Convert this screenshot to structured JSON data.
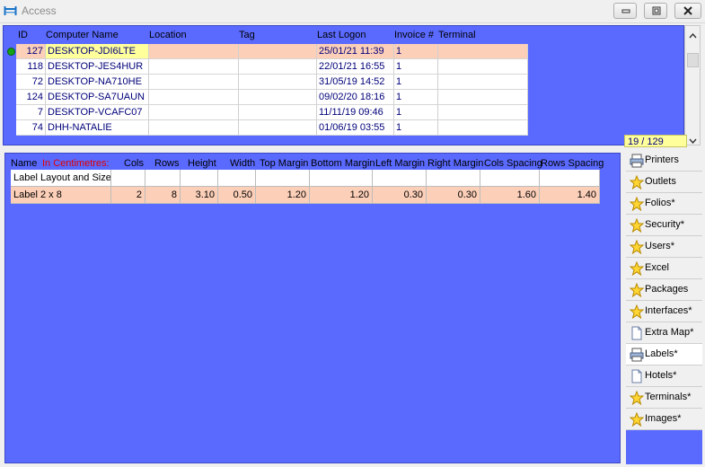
{
  "window": {
    "title": "Access",
    "icon": "app-window-icon",
    "buttons": [
      "minimize-icon",
      "maximize-icon",
      "close-icon"
    ]
  },
  "top_grid": {
    "columns": [
      "ID",
      "Computer Name",
      "Location",
      "Tag",
      "Last Logon",
      "Invoice #",
      "Terminal"
    ],
    "rows": [
      {
        "id": "127",
        "name": "DESKTOP-JDI6LTE",
        "location": "",
        "tag": "",
        "last_logon": "25/01/21 11:39",
        "invoice": "1",
        "terminal": ""
      },
      {
        "id": "118",
        "name": "DESKTOP-JES4HUR",
        "location": "",
        "tag": "",
        "last_logon": "22/01/21 16:55",
        "invoice": "1",
        "terminal": ""
      },
      {
        "id": "72",
        "name": "DESKTOP-NA710HE",
        "location": "",
        "tag": "",
        "last_logon": "31/05/19 14:52",
        "invoice": "1",
        "terminal": ""
      },
      {
        "id": "124",
        "name": "DESKTOP-SA7UAUN",
        "location": "",
        "tag": "",
        "last_logon": "09/02/20 18:16",
        "invoice": "1",
        "terminal": ""
      },
      {
        "id": "7",
        "name": "DESKTOP-VCAFC07",
        "location": "",
        "tag": "",
        "last_logon": "11/11/19 09:46",
        "invoice": "1",
        "terminal": ""
      },
      {
        "id": "74",
        "name": "DHH-NATALIE",
        "location": "",
        "tag": "",
        "last_logon": "01/06/19 03:55",
        "invoice": "1",
        "terminal": ""
      }
    ],
    "record_counter": "19 / 129"
  },
  "labels_grid": {
    "name_header": "Name",
    "unit_note": "In Centimetres:",
    "columns": [
      "Cols",
      "Rows",
      "Height",
      "Width",
      "Top Margin",
      "Bottom Margin",
      "Left Margin",
      "Right Margin",
      "Cols Spacing",
      "Rows Spacing"
    ],
    "rows": [
      {
        "name": "Label Layout and Size",
        "values": [
          "",
          "",
          "",
          "",
          "",
          "",
          "",
          "",
          "",
          ""
        ]
      },
      {
        "name": "Label 2 x 8",
        "values": [
          "2",
          "8",
          "3.10",
          "0.50",
          "1.20",
          "1.20",
          "0.30",
          "0.30",
          "1.60",
          "1.40"
        ]
      }
    ]
  },
  "sidebar": {
    "items": [
      {
        "label": "Printers",
        "icon": "printer-icon"
      },
      {
        "label": "Outlets",
        "icon": "star-icon"
      },
      {
        "label": "Folios*",
        "icon": "star-icon"
      },
      {
        "label": "Security*",
        "icon": "star-icon"
      },
      {
        "label": "Users*",
        "icon": "star-icon"
      },
      {
        "label": "Excel",
        "icon": "star-icon"
      },
      {
        "label": "Packages",
        "icon": "star-icon"
      },
      {
        "label": "Interfaces*",
        "icon": "star-icon"
      },
      {
        "label": "Extra Map*",
        "icon": "document-icon"
      },
      {
        "label": "Labels*",
        "icon": "printer-icon"
      },
      {
        "label": "Hotels*",
        "icon": "document-icon"
      },
      {
        "label": "Terminals*",
        "icon": "star-icon"
      },
      {
        "label": "Images*",
        "icon": "star-icon"
      }
    ],
    "active": "Labels*"
  },
  "colors": {
    "panel_blue": "#5a6aff",
    "selected_row": "#fccfb8",
    "selected_cell": "#ffff9b",
    "grid_text": "#00007a",
    "unit_note_red": "#e00000"
  }
}
